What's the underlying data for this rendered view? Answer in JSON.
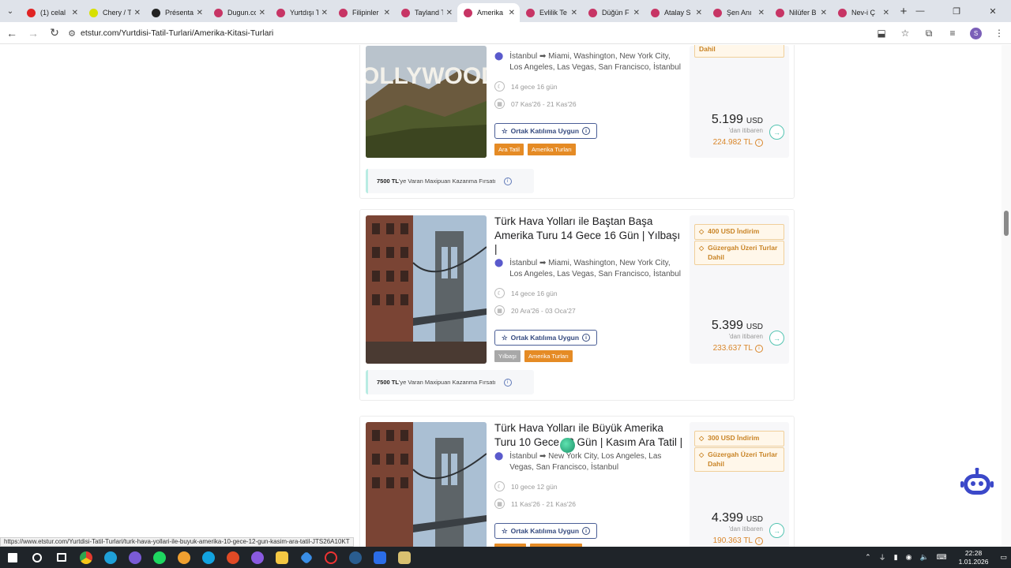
{
  "browser": {
    "tabs": [
      {
        "label": "(1) celal",
        "color": "#e02424"
      },
      {
        "label": "Chery / T",
        "color": "#d7e000"
      },
      {
        "label": "Présenta",
        "color": "#222222"
      },
      {
        "label": "Dugun.co",
        "color": "#c73565"
      },
      {
        "label": "Yurtdışı T",
        "color": "#c73565"
      },
      {
        "label": "Filipinler",
        "color": "#c73565"
      },
      {
        "label": "Tayland T",
        "color": "#c73565"
      },
      {
        "label": "Amerika",
        "color": "#c73565",
        "active": true
      },
      {
        "label": "Evlilik Te",
        "color": "#c73565"
      },
      {
        "label": "Düğün F",
        "color": "#c73565"
      },
      {
        "label": "Atalay S",
        "color": "#c73565"
      },
      {
        "label": "Şen Anı",
        "color": "#c73565"
      },
      {
        "label": "Nilüfer B",
        "color": "#c73565"
      },
      {
        "label": "Nev-i Ç",
        "color": "#c73565"
      }
    ],
    "url": "etstur.com/Yurtdisi-Tatil-Turlari/Amerika-Kitasi-Turlari",
    "status_url": "https://www.etstur.com/Yurtdisi-Tatil-Turlari/turk-hava-yollari-ile-buyuk-amerika-10-gece-12-gun-kasim-ara-tatil-JTS26A10KT",
    "profile_initial": "S"
  },
  "tours": [
    {
      "title_partial": "",
      "route": "İstanbul ➡ Miami, Washington, New York City, Los Angeles, Las Vegas, San Francisco, İstanbul",
      "duration": "14 gece 16 gün",
      "dates": "07 Kas'26 - 21 Kas'26",
      "join_label": "Ortak Katılıma Uygun",
      "tags": [
        {
          "label": "Ara Tatil",
          "style": "or"
        },
        {
          "label": "Amerika Turları",
          "style": "or"
        }
      ],
      "badges": [
        "Dahil"
      ],
      "price": "5.199",
      "currency": "USD",
      "from_label": "'dan itibaren",
      "tl_price": "224.982 TL",
      "points_bold": "7500 TL",
      "points_text": "'ye Varan Maxipuan Kazanma Fırsatı"
    },
    {
      "title": "Türk Hava Yolları ile Baştan Başa Amerika Turu 14 Gece 16 Gün | Yılbaşı |",
      "route": "İstanbul ➡ Miami, Washington, New York City, Los Angeles, Las Vegas, San Francisco, İstanbul",
      "duration": "14 gece 16 gün",
      "dates": "20 Ara'26 - 03 Oca'27",
      "join_label": "Ortak Katılıma Uygun",
      "tags": [
        {
          "label": "Yılbaşı",
          "style": "gr"
        },
        {
          "label": "Amerika Turları",
          "style": "or"
        }
      ],
      "badges": [
        "400 USD İndirim",
        "Güzergah Üzeri Turlar Dahil"
      ],
      "price": "5.399",
      "currency": "USD",
      "from_label": "'dan itibaren",
      "tl_price": "233.637 TL",
      "points_bold": "7500 TL",
      "points_text": "'ye Varan Maxipuan Kazanma Fırsatı"
    },
    {
      "title": "Türk Hava Yolları ile Büyük Amerika Turu 10 Gece 12 Gün | Kasım Ara Tatil |",
      "route": "İstanbul ➡ New York City, Los Angeles, Las Vegas, San Francisco, İstanbul",
      "duration": "10 gece 12 gün",
      "dates": "11 Kas'26 - 21 Kas'26",
      "join_label": "Ortak Katılıma Uygun",
      "tags": [],
      "badges": [
        "300 USD İndirim",
        "Güzergah Üzeri Turlar Dahil"
      ],
      "price": "4.399",
      "currency": "USD",
      "from_label": "'dan itibaren",
      "tl_price": "190.363 TL"
    }
  ],
  "image_text": "OLLYWOOD",
  "taskbar": {
    "time": "22:28",
    "date": "1.01.2026"
  }
}
